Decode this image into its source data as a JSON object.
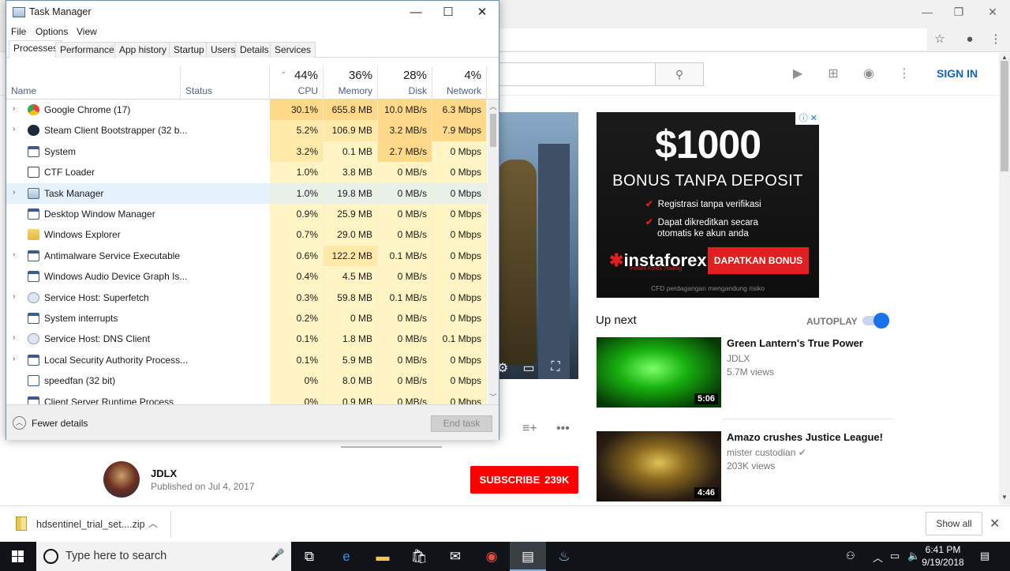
{
  "taskmanager": {
    "title": "Task Manager",
    "window_controls": {
      "minimize": "—",
      "maximize": "☐",
      "close": "✕"
    },
    "menu": [
      "File",
      "Options",
      "View"
    ],
    "tabs": [
      "Processes",
      "Performance",
      "App history",
      "Startup",
      "Users",
      "Details",
      "Services"
    ],
    "active_tab": "Processes",
    "columns": {
      "name": "Name",
      "status": "Status",
      "cpu": {
        "pct": "44%",
        "label": "CPU"
      },
      "memory": {
        "pct": "36%",
        "label": "Memory"
      },
      "disk": {
        "pct": "28%",
        "label": "Disk"
      },
      "network": {
        "pct": "4%",
        "label": "Network"
      }
    },
    "processes": [
      {
        "name": "Google Chrome (17)",
        "expand": true,
        "icon": "chrome-icon",
        "cpu": "30.1%",
        "memory": "655.8 MB",
        "disk": "10.0 MB/s",
        "network": "6.3 Mbps"
      },
      {
        "name": "Steam Client Bootstrapper (32 b...",
        "expand": true,
        "icon": "steam-icon",
        "cpu": "5.2%",
        "memory": "106.9 MB",
        "disk": "3.2 MB/s",
        "network": "7.9 Mbps"
      },
      {
        "name": "System",
        "expand": false,
        "icon": "system-icon",
        "cpu": "3.2%",
        "memory": "0.1 MB",
        "disk": "2.7 MB/s",
        "network": "0 Mbps"
      },
      {
        "name": "CTF Loader",
        "expand": false,
        "icon": "ctf-loader-icon",
        "cpu": "1.0%",
        "memory": "3.8 MB",
        "disk": "0 MB/s",
        "network": "0 Mbps"
      },
      {
        "name": "Task Manager",
        "expand": true,
        "icon": "task-manager-icon",
        "cpu": "1.0%",
        "memory": "19.8 MB",
        "disk": "0 MB/s",
        "network": "0 Mbps"
      },
      {
        "name": "Desktop Window Manager",
        "expand": false,
        "icon": "window-icon",
        "cpu": "0.9%",
        "memory": "25.9 MB",
        "disk": "0 MB/s",
        "network": "0 Mbps"
      },
      {
        "name": "Windows Explorer",
        "expand": false,
        "icon": "folder-icon",
        "cpu": "0.7%",
        "memory": "29.0 MB",
        "disk": "0 MB/s",
        "network": "0 Mbps"
      },
      {
        "name": "Antimalware Service Executable",
        "expand": true,
        "icon": "window-icon",
        "cpu": "0.6%",
        "memory": "122.2 MB",
        "disk": "0.1 MB/s",
        "network": "0 Mbps"
      },
      {
        "name": "Windows Audio Device Graph Is...",
        "expand": false,
        "icon": "window-icon",
        "cpu": "0.4%",
        "memory": "4.5 MB",
        "disk": "0 MB/s",
        "network": "0 Mbps"
      },
      {
        "name": "Service Host: Superfetch",
        "expand": true,
        "icon": "gear-icon",
        "cpu": "0.3%",
        "memory": "59.8 MB",
        "disk": "0.1 MB/s",
        "network": "0 Mbps"
      },
      {
        "name": "System interrupts",
        "expand": false,
        "icon": "window-icon",
        "cpu": "0.2%",
        "memory": "0 MB",
        "disk": "0 MB/s",
        "network": "0 Mbps"
      },
      {
        "name": "Service Host: DNS Client",
        "expand": true,
        "icon": "gear-icon",
        "cpu": "0.1%",
        "memory": "1.8 MB",
        "disk": "0 MB/s",
        "network": "0.1 Mbps"
      },
      {
        "name": "Local Security Authority Process...",
        "expand": true,
        "icon": "window-icon",
        "cpu": "0.1%",
        "memory": "5.9 MB",
        "disk": "0 MB/s",
        "network": "0 Mbps"
      },
      {
        "name": "speedfan (32 bit)",
        "expand": false,
        "icon": "speedfan-icon",
        "cpu": "0%",
        "memory": "8.0 MB",
        "disk": "0 MB/s",
        "network": "0 Mbps"
      },
      {
        "name": "Client Server Runtime Process",
        "expand": false,
        "icon": "window-icon",
        "cpu": "0%",
        "memory": "0.9 MB",
        "disk": "0 MB/s",
        "network": "0 Mbps"
      }
    ],
    "fewer_details": "Fewer details",
    "end_task": "End task"
  },
  "chrome": {
    "window_controls": {
      "minimize": "—",
      "maximize": "❐",
      "close": "✕"
    }
  },
  "youtube": {
    "sign_in": "SIGN IN",
    "channel": {
      "name": "JDLX",
      "published": "Published on Jul 4, 2017"
    },
    "subscribe": {
      "label": "SUBSCRIBE",
      "count": "239K"
    },
    "ad": {
      "amount": "$1000",
      "headline": "BONUS TANPA DEPOSIT",
      "bullet1": "Registrasi tanpa verifikasi",
      "bullet2a": "Dapat dikreditkan secara",
      "bullet2b": "otomatis ke akun anda",
      "brand": "instaforex",
      "brand_sub": "Instant Forex Trading",
      "cta": "DAPATKAN BONUS",
      "footer": "CFD perdagangan mengandung risiko"
    },
    "up_next": "Up next",
    "autoplay": "AUTOPLAY",
    "autoplay_on": true,
    "recommendations": [
      {
        "title": "Green Lantern's True Power",
        "channel": "JDLX",
        "views": "5.7M views",
        "duration": "5:06"
      },
      {
        "title": "Amazo crushes Justice League!",
        "channel": "mister custodian",
        "views": "203K views",
        "duration": "4:46"
      }
    ]
  },
  "download_bar": {
    "filename": "hdsentinel_trial_set....zip",
    "show_all": "Show all"
  },
  "taskbar": {
    "search_placeholder": "Type here to search",
    "time": "6:41 PM",
    "date": "9/19/2018"
  },
  "colors": {
    "accent_youtube": "#ff0000",
    "sign_in_blue": "#1565c0",
    "heat_light": "#fff4c4",
    "heat_high": "#ffd98a"
  }
}
